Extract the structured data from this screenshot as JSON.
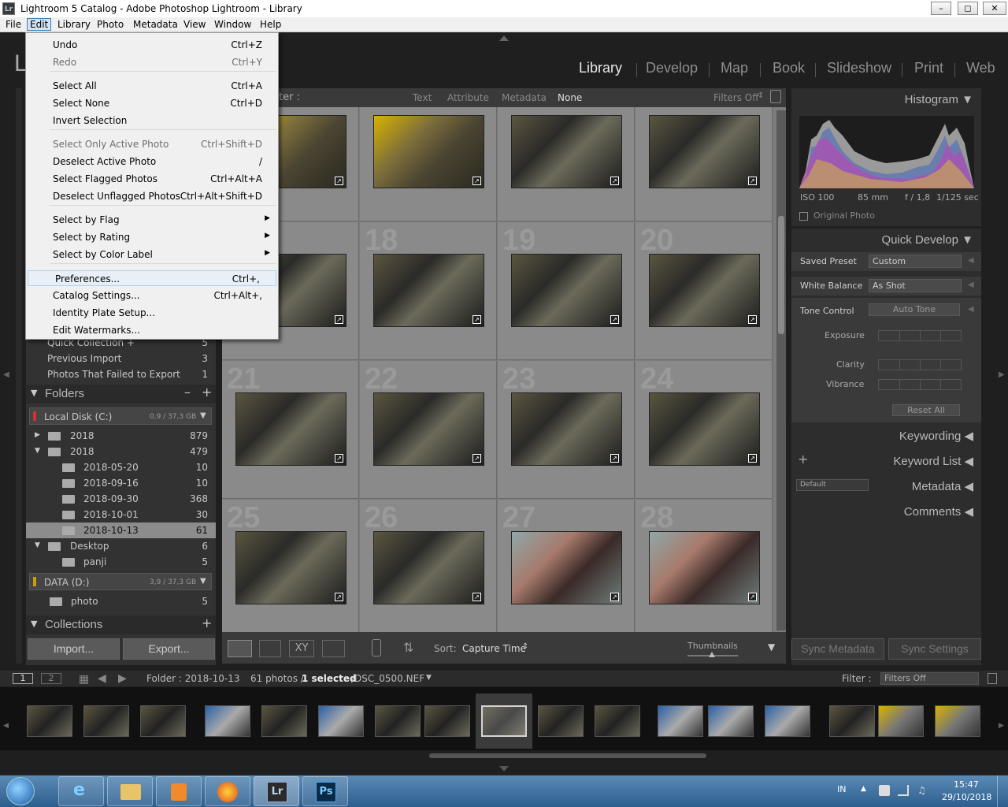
{
  "window": {
    "title": "Lightroom 5 Catalog - Adobe Photoshop Lightroom - Library",
    "app_icon": "Lr"
  },
  "menubar": [
    "File",
    "Edit",
    "Library",
    "Photo",
    "Metadata",
    "View",
    "Window",
    "Help"
  ],
  "modules": [
    "Library",
    "Develop",
    "Map",
    "Book",
    "Slideshow",
    "Print",
    "Web"
  ],
  "edit_menu": [
    {
      "label": "Undo",
      "shortcut": "Ctrl+Z",
      "disabled": false
    },
    {
      "label": "Redo",
      "shortcut": "Ctrl+Y",
      "disabled": true
    },
    {
      "label": "Select All",
      "shortcut": "Ctrl+A",
      "disabled": false
    },
    {
      "label": "Select None",
      "shortcut": "Ctrl+D",
      "disabled": false
    },
    {
      "label": "Invert Selection",
      "shortcut": "",
      "disabled": false
    },
    {
      "label": "Select Only Active Photo",
      "shortcut": "Ctrl+Shift+D",
      "disabled": true
    },
    {
      "label": "Deselect Active Photo",
      "shortcut": "/",
      "disabled": false
    },
    {
      "label": "Select Flagged Photos",
      "shortcut": "Ctrl+Alt+A",
      "disabled": false
    },
    {
      "label": "Deselect Unflagged Photos",
      "shortcut": "Ctrl+Alt+Shift+D",
      "disabled": false
    },
    {
      "label": "Select by Flag",
      "shortcut": "",
      "disabled": false,
      "submenu": true
    },
    {
      "label": "Select by Rating",
      "shortcut": "",
      "disabled": false,
      "submenu": true
    },
    {
      "label": "Select by Color Label",
      "shortcut": "",
      "disabled": false,
      "submenu": true
    },
    {
      "label": "Preferences...",
      "shortcut": "Ctrl+,",
      "disabled": false,
      "highlighted": true
    },
    {
      "label": "Catalog Settings...",
      "shortcut": "Ctrl+Alt+,",
      "disabled": false
    },
    {
      "label": "Identity Plate Setup...",
      "shortcut": "",
      "disabled": false
    },
    {
      "label": "Edit Watermarks...",
      "shortcut": "",
      "disabled": false
    }
  ],
  "catalog": [
    {
      "label": "Quick Collection +",
      "count": "5"
    },
    {
      "label": "Previous Import",
      "count": "3"
    },
    {
      "label": "Photos That Failed to Export",
      "count": "1"
    }
  ],
  "folders": {
    "title": "Folders",
    "volume1": {
      "name": "Local Disk (C:)",
      "size": "0,9 / 37,3 GB"
    },
    "items": [
      {
        "label": "2018",
        "count": "879",
        "level": 0
      },
      {
        "label": "2018",
        "count": "479",
        "level": 0
      },
      {
        "label": "2018-05-20",
        "count": "10",
        "level": 1
      },
      {
        "label": "2018-09-16",
        "count": "10",
        "level": 1
      },
      {
        "label": "2018-09-30",
        "count": "368",
        "level": 1
      },
      {
        "label": "2018-10-01",
        "count": "30",
        "level": 1
      },
      {
        "label": "2018-10-13",
        "count": "61",
        "level": 1,
        "selected": true
      },
      {
        "label": "Desktop",
        "count": "6",
        "level": 0
      },
      {
        "label": "panji",
        "count": "5",
        "level": 1
      }
    ],
    "volume2": {
      "name": "DATA (D:)",
      "size": "3,9 / 37,3 GB"
    },
    "items2": [
      {
        "label": "photo",
        "count": "5"
      }
    ]
  },
  "collections_title": "Collections",
  "import_label": "Import...",
  "export_label": "Export...",
  "filterbar": {
    "label": "ter :",
    "tabs": [
      "Text",
      "Attribute",
      "Metadata",
      "None"
    ],
    "filters": "Filters Off"
  },
  "grid_numbers": [
    "18",
    "19",
    "20",
    "21",
    "22",
    "23",
    "24",
    "25",
    "26",
    "27",
    "28"
  ],
  "toolbar": {
    "sort_label": "Sort:",
    "sort_value": "Capture Time",
    "thumbnails": "Thumbnails"
  },
  "histogram": {
    "title": "Histogram",
    "iso": "ISO 100",
    "focal": "85 mm",
    "aperture": "f / 1,8",
    "shutter": "1/125 sec",
    "original": "Original Photo"
  },
  "quick_develop": {
    "title": "Quick Develop",
    "saved_preset": "Saved Preset",
    "saved_preset_value": "Custom",
    "white_balance": "White Balance",
    "white_balance_value": "As Shot",
    "tone_control": "Tone Control",
    "auto_tone": "Auto Tone",
    "exposure": "Exposure",
    "clarity": "Clarity",
    "vibrance": "Vibrance",
    "reset": "Reset All"
  },
  "right_sections": {
    "keywording": "Keywording",
    "keyword_list": "Keyword List",
    "metadata": "Metadata",
    "metadata_preset": "Default",
    "comments": "Comments"
  },
  "sync": {
    "metadata": "Sync Metadata",
    "settings": "Sync Settings"
  },
  "infobar": {
    "page1": "1",
    "page2": "2",
    "folder": "Folder : 2018-10-13",
    "count": "61 photos /",
    "selected": "1 selected",
    "file": "/DSC_0500.NEF",
    "filter_label": "Filter :",
    "filter_value": "Filters Off"
  },
  "taskbar": {
    "lang": "IN",
    "time": "15:47",
    "date": "29/10/2018"
  }
}
